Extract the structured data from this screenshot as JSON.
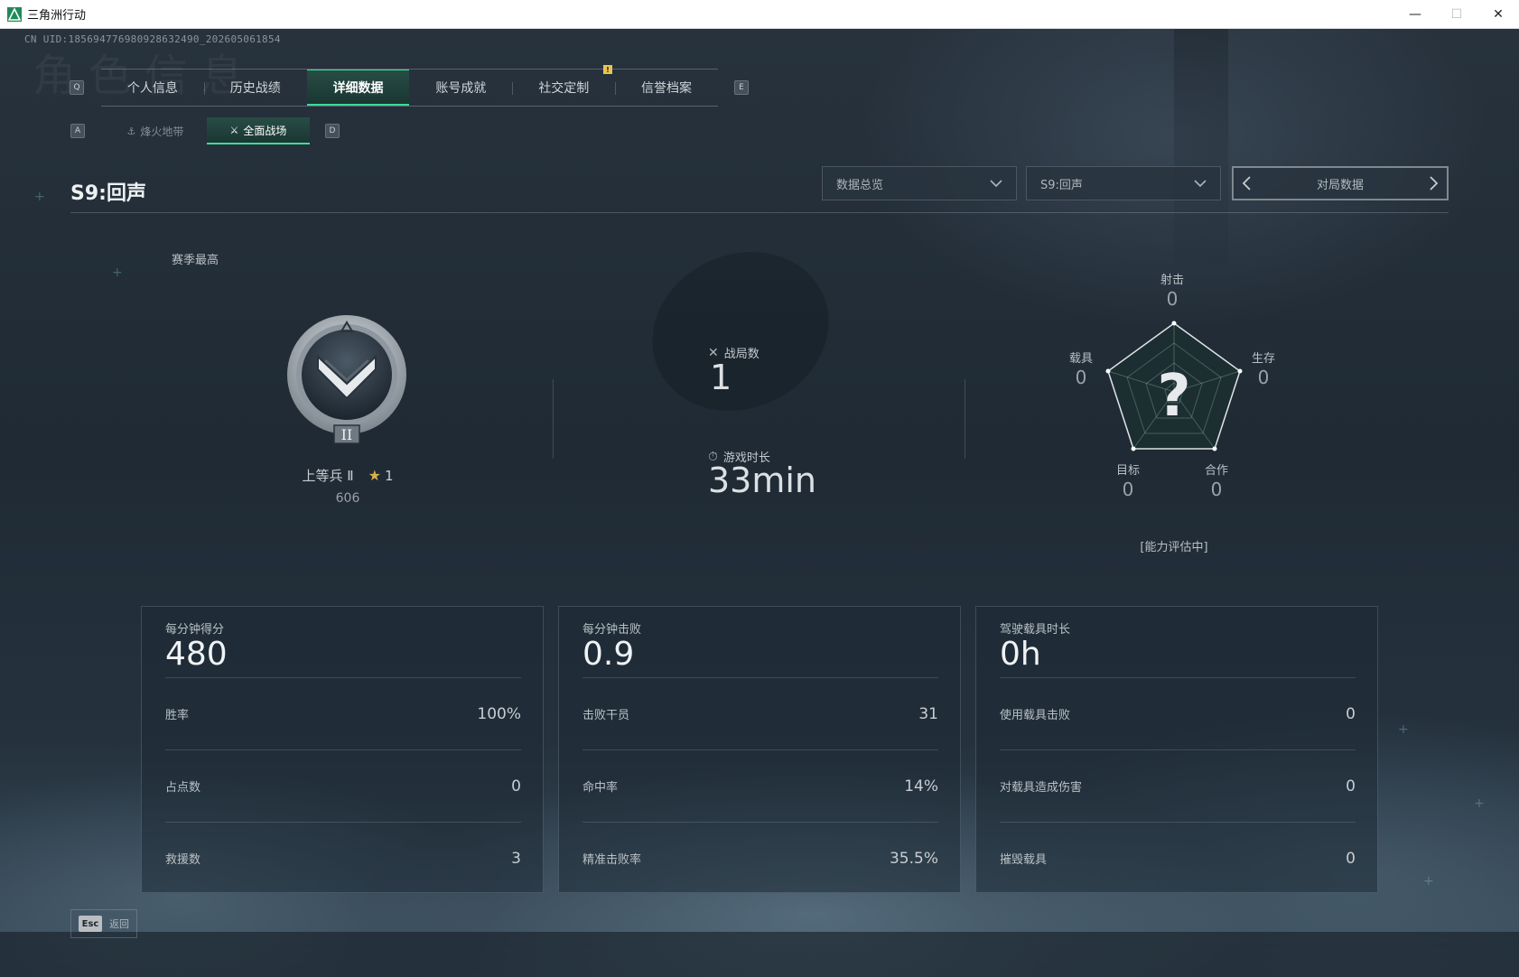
{
  "window": {
    "title": "三角洲行动",
    "minimize": "—",
    "maximize": "☐",
    "close": "✕"
  },
  "uid": "CN UID:18569477698092863249​0_202605061854",
  "watermark": "角色信息",
  "tabs": {
    "prev_key": "Q",
    "next_key": "E",
    "items": [
      {
        "label": "个人信息",
        "active": false
      },
      {
        "label": "历史战绩",
        "active": false
      },
      {
        "label": "详细数据",
        "active": true
      },
      {
        "label": "账号成就",
        "active": false
      },
      {
        "label": "社交定制",
        "active": false
      },
      {
        "label": "信誉档案",
        "active": false
      }
    ],
    "notice_badge": "!"
  },
  "subtabs": {
    "prev_key": "A",
    "next_key": "D",
    "items": [
      {
        "label": "烽火地带",
        "icon": "hazard-icon",
        "active": false
      },
      {
        "label": "全面战场",
        "icon": "battlefield-icon",
        "active": true
      }
    ]
  },
  "header": {
    "season_title": "S9:回声",
    "dropdown_overview": "数据总览",
    "dropdown_season": "S9:回声",
    "pager_label": "对局数据"
  },
  "season_best": {
    "label": "赛季最高",
    "rank_name": "上等兵 Ⅱ",
    "rank_numeral": "II",
    "stars": "1",
    "score": "606"
  },
  "summary": {
    "matches_label": "战局数",
    "matches_value": "1",
    "playtime_label": "游戏时长",
    "playtime_value": "33min"
  },
  "radar": {
    "center": "?",
    "axes": [
      {
        "label": "射击",
        "value": "0"
      },
      {
        "label": "生存",
        "value": "0"
      },
      {
        "label": "合作",
        "value": "0"
      },
      {
        "label": "目标",
        "value": "0"
      },
      {
        "label": "载具",
        "value": "0"
      }
    ],
    "status": "[能力评估中]"
  },
  "cards": [
    {
      "head_label": "每分钟得分",
      "head_value": "480",
      "rows": [
        {
          "k": "胜率",
          "v": "100%"
        },
        {
          "k": "占点数",
          "v": "0"
        },
        {
          "k": "救援数",
          "v": "3"
        }
      ]
    },
    {
      "head_label": "每分钟击败",
      "head_value": "0.9",
      "rows": [
        {
          "k": "击败干员",
          "v": "31"
        },
        {
          "k": "命中率",
          "v": "14%"
        },
        {
          "k": "精准击败率",
          "v": "35.5%"
        }
      ]
    },
    {
      "head_label": "驾驶载具时长",
      "head_value": "0h",
      "rows": [
        {
          "k": "使用载具击败",
          "v": "0"
        },
        {
          "k": "对载具造成伤害",
          "v": "0"
        },
        {
          "k": "摧毁载具",
          "v": "0"
        }
      ]
    }
  ],
  "footer": {
    "esc_key": "Esc",
    "esc_label": "返回"
  },
  "colors": {
    "accent": "#3ddc97",
    "star": "#d7b14a",
    "badge": "#e8c450"
  }
}
